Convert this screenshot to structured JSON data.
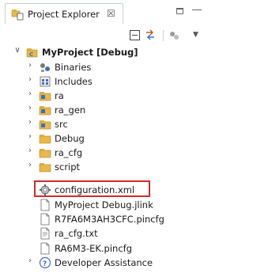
{
  "panel": {
    "title": "Project Explorer",
    "close_glyph": "☒"
  },
  "tree": {
    "root": {
      "label": "MyProject [Debug]",
      "icon": "project-icon"
    },
    "items": [
      {
        "label": "Binaries",
        "icon": "binaries-icon",
        "expandable": true
      },
      {
        "label": "Includes",
        "icon": "includes-icon",
        "expandable": true
      },
      {
        "label": "ra",
        "icon": "source-folder-icon",
        "expandable": true
      },
      {
        "label": "ra_gen",
        "icon": "source-folder-icon",
        "expandable": true
      },
      {
        "label": "src",
        "icon": "source-folder-icon",
        "expandable": true
      },
      {
        "label": "Debug",
        "icon": "folder-icon",
        "expandable": true
      },
      {
        "label": "ra_cfg",
        "icon": "folder-icon",
        "expandable": true
      },
      {
        "label": "script",
        "icon": "folder-icon",
        "expandable": true
      },
      {
        "label": "configuration.xml",
        "icon": "gear-file-icon",
        "expandable": false,
        "highlighted": true
      },
      {
        "label": "MyProject Debug.jlink",
        "icon": "file-icon",
        "expandable": false
      },
      {
        "label": "R7FA6M3AH3CFC.pincfg",
        "icon": "file-icon",
        "expandable": false
      },
      {
        "label": "ra_cfg.txt",
        "icon": "file-icon",
        "expandable": false
      },
      {
        "label": "RA6M3-EK.pincfg",
        "icon": "file-icon",
        "expandable": false
      },
      {
        "label": "Developer Assistance",
        "icon": "help-icon",
        "expandable": true
      }
    ]
  },
  "colors": {
    "highlight_border": "#d42a2a",
    "folder": "#e8b84a",
    "source_folder_accent": "#3b6fc2"
  }
}
